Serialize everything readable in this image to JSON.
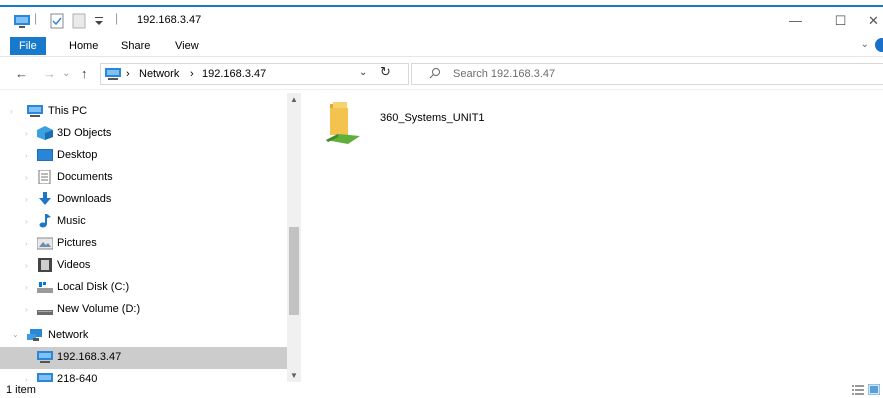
{
  "window": {
    "title": "192.168.3.47",
    "qat_divider": "|",
    "controls": {
      "minimize": "—",
      "maximize": "☐",
      "close": "✕"
    }
  },
  "ribbon": {
    "tabs": [
      "File",
      "Home",
      "Share",
      "View"
    ],
    "expand_glyph": "⌄"
  },
  "address": {
    "back": "←",
    "forward": "→",
    "recent": "⌄",
    "up": "↑",
    "separator": "›",
    "crumbs": [
      "Network",
      "192.168.3.47"
    ],
    "dropdown": "⌄",
    "refresh": "↻"
  },
  "search": {
    "placeholder": "Search 192.168.3.47",
    "icon_glyph": "⚲"
  },
  "nav": {
    "items": [
      {
        "label": "This PC",
        "icon": "pc-icon"
      },
      {
        "label": "3D Objects",
        "icon": "3d-objects-icon"
      },
      {
        "label": "Desktop",
        "icon": "desktop-icon"
      },
      {
        "label": "Documents",
        "icon": "documents-icon"
      },
      {
        "label": "Downloads",
        "icon": "downloads-icon"
      },
      {
        "label": "Music",
        "icon": "music-icon"
      },
      {
        "label": "Pictures",
        "icon": "pictures-icon"
      },
      {
        "label": "Videos",
        "icon": "videos-icon"
      },
      {
        "label": "Local Disk (C:)",
        "icon": "local-disk-icon"
      },
      {
        "label": "New Volume (D:)",
        "icon": "drive-icon"
      },
      {
        "label": "Network",
        "icon": "network-icon"
      },
      {
        "label": "192.168.3.47",
        "icon": "pc-icon",
        "selected": true
      },
      {
        "label": "218-640",
        "icon": "pc-icon"
      }
    ],
    "expand_glyph": "›"
  },
  "content": {
    "items": [
      {
        "name": "360_Systems_UNIT1",
        "icon": "shared-folder-icon"
      }
    ]
  },
  "status": {
    "item_count": "1 item"
  },
  "colors": {
    "accent": "#1979ca",
    "selection": "#cccccc",
    "folder": "#f3c24f"
  }
}
